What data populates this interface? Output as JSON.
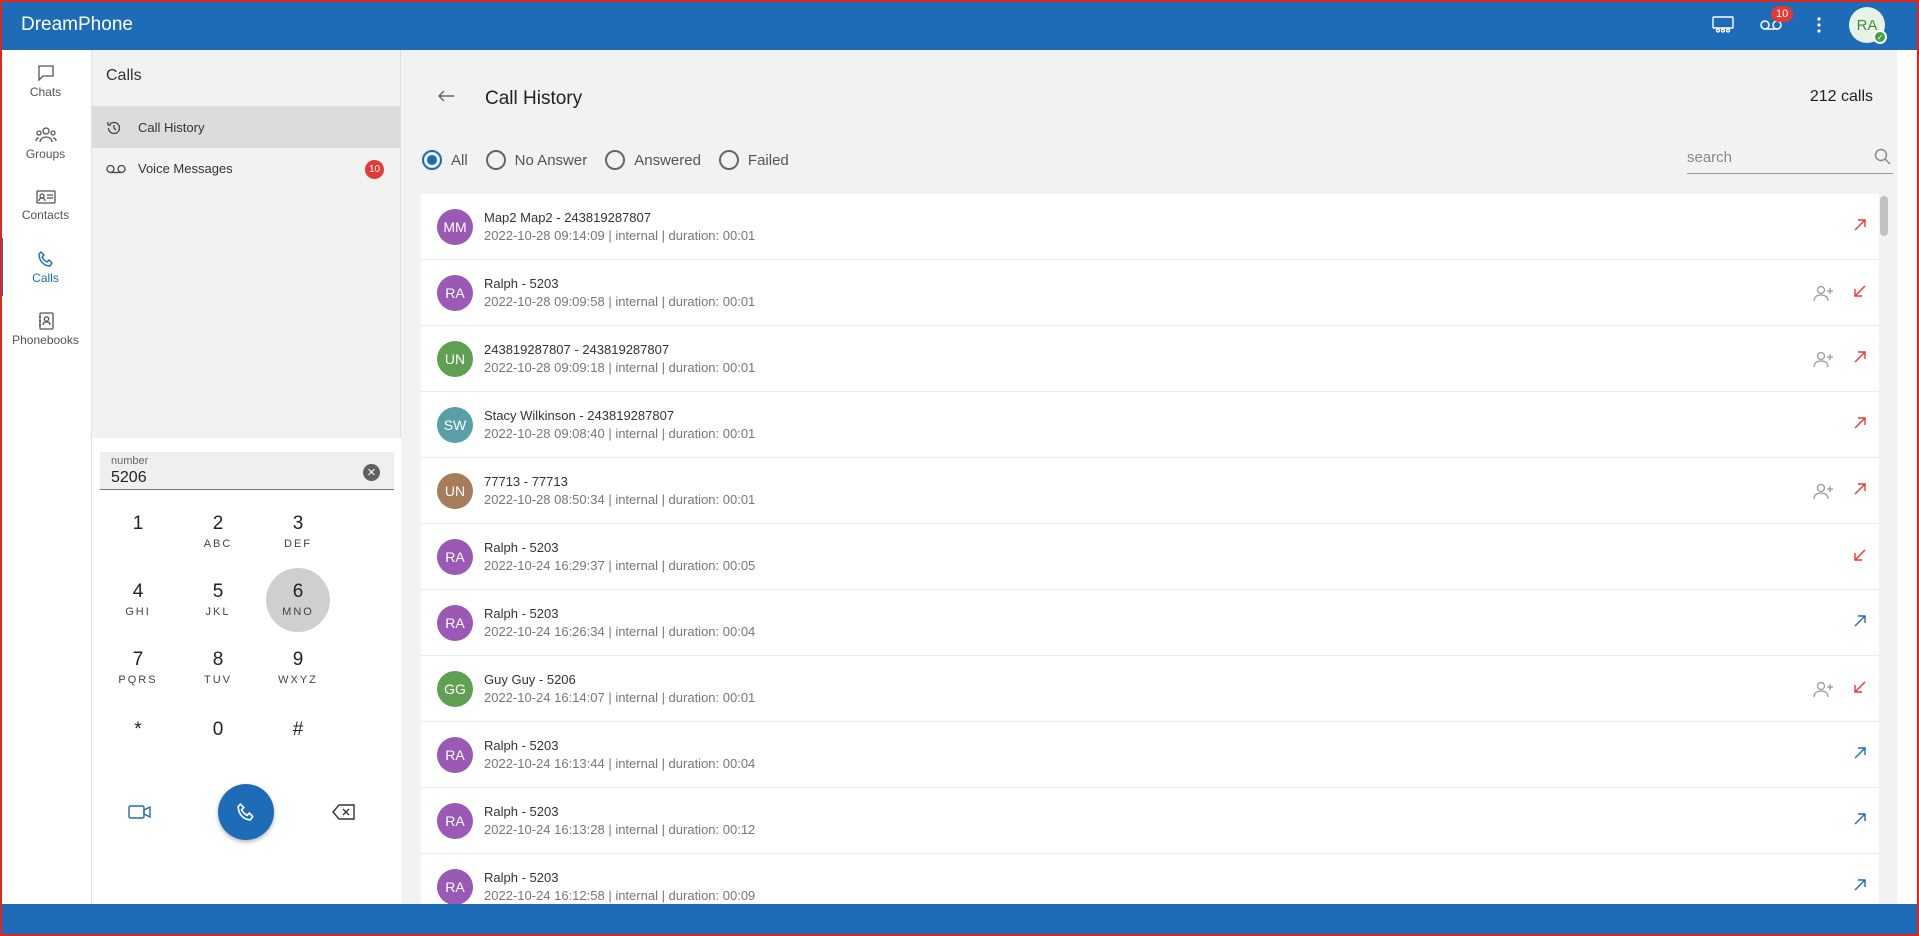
{
  "app": {
    "title": "DreamPhone"
  },
  "topbar": {
    "voicemail_badge": "10",
    "avatar_initials": "RA"
  },
  "nav": [
    {
      "label": "Chats",
      "icon": "chat-icon"
    },
    {
      "label": "Groups",
      "icon": "groups-icon"
    },
    {
      "label": "Contacts",
      "icon": "contacts-icon"
    },
    {
      "label": "Calls",
      "icon": "phone-icon",
      "active": true
    },
    {
      "label": "Phonebooks",
      "icon": "phonebook-icon"
    }
  ],
  "calls_panel": {
    "title": "Calls",
    "items": [
      {
        "label": "Call History",
        "icon": "history-icon",
        "active": true
      },
      {
        "label": "Voice Messages",
        "icon": "voicemail-icon",
        "badge": "10"
      }
    ]
  },
  "dialer": {
    "label": "number",
    "value": "5206",
    "keys": [
      {
        "digit": "1",
        "letters": ""
      },
      {
        "digit": "2",
        "letters": "ABC"
      },
      {
        "digit": "3",
        "letters": "DEF"
      },
      {
        "digit": "4",
        "letters": "GHI"
      },
      {
        "digit": "5",
        "letters": "JKL"
      },
      {
        "digit": "6",
        "letters": "MNO"
      },
      {
        "digit": "7",
        "letters": "PQRS"
      },
      {
        "digit": "8",
        "letters": "TUV"
      },
      {
        "digit": "9",
        "letters": "WXYZ"
      },
      {
        "digit": "*",
        "letters": ""
      },
      {
        "digit": "0",
        "letters": ""
      },
      {
        "digit": "#",
        "letters": ""
      }
    ],
    "pressed_key": "6"
  },
  "main": {
    "title": "Call History",
    "count": "212 calls",
    "filters": [
      "All",
      "No Answer",
      "Answered",
      "Failed"
    ],
    "selected_filter": "All",
    "search_placeholder": "search"
  },
  "colors": {
    "accent": "#1e6bb8",
    "outgoing_red": "#e53935",
    "outgoing_blue": "#1e6bb8",
    "avatar_purple": "#9b59b6",
    "avatar_green": "#5fa052",
    "avatar_teal": "#5a9fa8",
    "avatar_brown": "#a57d5a"
  },
  "calls": [
    {
      "initials": "MM",
      "color": "#9b59b6",
      "name": "Map2 Map2  - 243819287807",
      "details": "2022-10-28 09:14:09 | internal | duration: 00:01",
      "add_contact": false,
      "direction": "outgoing",
      "dir_color": "#e53935"
    },
    {
      "initials": "RA",
      "color": "#9b59b6",
      "name": "Ralph  - 5203",
      "details": "2022-10-28 09:09:58 | internal | duration: 00:01",
      "add_contact": true,
      "direction": "incoming",
      "dir_color": "#e53935"
    },
    {
      "initials": "UN",
      "color": "#5fa052",
      "name": "243819287807  - 243819287807",
      "details": "2022-10-28 09:09:18 | internal | duration: 00:01",
      "add_contact": true,
      "direction": "outgoing",
      "dir_color": "#e53935"
    },
    {
      "initials": "SW",
      "color": "#5a9fa8",
      "name": "Stacy Wilkinson  - 243819287807",
      "details": "2022-10-28 09:08:40 | internal | duration: 00:01",
      "add_contact": false,
      "direction": "outgoing",
      "dir_color": "#e53935"
    },
    {
      "initials": "UN",
      "color": "#a57d5a",
      "name": "77713  - 77713",
      "details": "2022-10-28 08:50:34 | internal | duration: 00:01",
      "add_contact": true,
      "direction": "outgoing",
      "dir_color": "#e53935"
    },
    {
      "initials": "RA",
      "color": "#9b59b6",
      "name": "Ralph  - 5203",
      "details": "2022-10-24 16:29:37 | internal | duration: 00:05",
      "add_contact": false,
      "direction": "incoming",
      "dir_color": "#e53935"
    },
    {
      "initials": "RA",
      "color": "#9b59b6",
      "name": "Ralph  - 5203",
      "details": "2022-10-24 16:26:34 | internal | duration: 00:04",
      "add_contact": false,
      "direction": "outgoing",
      "dir_color": "#1e6bb8"
    },
    {
      "initials": "GG",
      "color": "#5fa052",
      "name": "Guy Guy  - 5206",
      "details": "2022-10-24 16:14:07 | internal | duration: 00:01",
      "add_contact": true,
      "direction": "incoming",
      "dir_color": "#e53935"
    },
    {
      "initials": "RA",
      "color": "#9b59b6",
      "name": "Ralph  - 5203",
      "details": "2022-10-24 16:13:44 | internal | duration: 00:04",
      "add_contact": false,
      "direction": "outgoing",
      "dir_color": "#1e6bb8"
    },
    {
      "initials": "RA",
      "color": "#9b59b6",
      "name": "Ralph  - 5203",
      "details": "2022-10-24 16:13:28 | internal | duration: 00:12",
      "add_contact": false,
      "direction": "outgoing",
      "dir_color": "#1e6bb8"
    },
    {
      "initials": "RA",
      "color": "#9b59b6",
      "name": "Ralph  - 5203",
      "details": "2022-10-24 16:12:58 | internal | duration: 00:09",
      "add_contact": false,
      "direction": "outgoing",
      "dir_color": "#1e6bb8"
    }
  ]
}
